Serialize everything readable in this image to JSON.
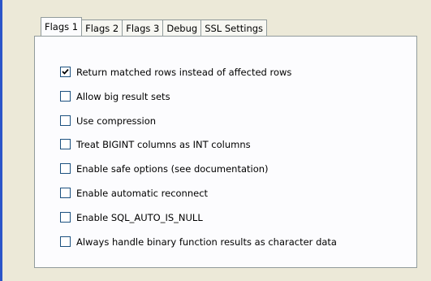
{
  "tabs": [
    {
      "label": "Flags 1",
      "active": true
    },
    {
      "label": "Flags 2",
      "active": false
    },
    {
      "label": "Flags 3",
      "active": false
    },
    {
      "label": "Debug",
      "active": false
    },
    {
      "label": "SSL Settings",
      "active": false
    }
  ],
  "options": [
    {
      "label": "Return matched rows instead of affected rows",
      "checked": true
    },
    {
      "label": "Allow big result sets",
      "checked": false
    },
    {
      "label": "Use compression",
      "checked": false
    },
    {
      "label": "Treat BIGINT columns as INT columns",
      "checked": false
    },
    {
      "label": "Enable safe options (see documentation)",
      "checked": false
    },
    {
      "label": "Enable automatic reconnect",
      "checked": false
    },
    {
      "label": "Enable SQL_AUTO_IS_NULL",
      "checked": false
    },
    {
      "label": "Always handle binary function results as character data",
      "checked": false
    }
  ],
  "colors": {
    "panel": "#ece9d8",
    "tab_border": "#919b9c",
    "checkbox_border": "#1c5180",
    "accent_bar": "#2b55c9"
  },
  "icons": {
    "checkmark": "check-icon"
  }
}
